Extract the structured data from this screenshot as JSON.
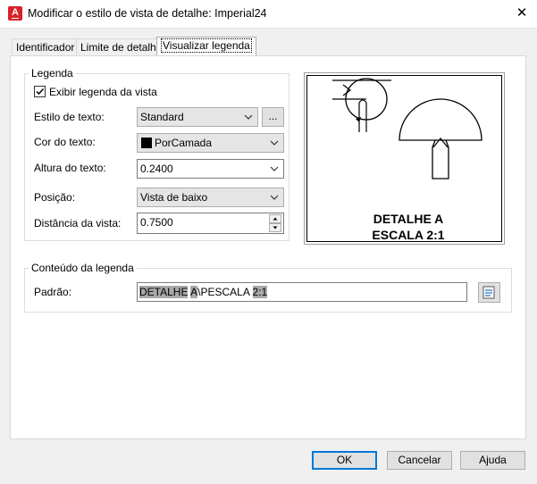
{
  "window": {
    "title": "Modificar o estilo de vista de detalhe: Imperial24",
    "app_icon_letter": "A"
  },
  "tabs": [
    {
      "label": "Identificador"
    },
    {
      "label": "Limite de detalhe"
    },
    {
      "label": "Visualizar legenda"
    }
  ],
  "legend_group": {
    "title": "Legenda",
    "show_label_checkbox": {
      "label": "Exibir legenda da vista",
      "checked": true
    },
    "text_style": {
      "label": "Estilo de texto:",
      "value": "Standard",
      "browse_label": "..."
    },
    "text_color": {
      "label": "Cor do texto:",
      "value": "PorCamada",
      "swatch_color": "#000000"
    },
    "text_height": {
      "label": "Altura do texto:",
      "value": "0.2400"
    },
    "position": {
      "label": "Posição:",
      "value": "Vista de baixo"
    },
    "distance": {
      "label": "Distância da vista:",
      "value": "0.7500"
    }
  },
  "preview": {
    "caption_line1": "DETALHE A",
    "caption_line2": "ESCALA 2:1"
  },
  "content_group": {
    "title": "Conteúdo da legenda",
    "pattern_label": "Padrão:",
    "pattern_segments": [
      {
        "text": "DETALHE",
        "highlighted": true
      },
      {
        "text": " ",
        "highlighted": false
      },
      {
        "text": "A",
        "highlighted": true
      },
      {
        "text": "\\PESCALA ",
        "highlighted": false
      },
      {
        "text": "2:1",
        "highlighted": true
      }
    ]
  },
  "buttons": {
    "ok": "OK",
    "cancel": "Cancelar",
    "help": "Ajuda"
  },
  "colors": {
    "accent": "#0078d7",
    "app_icon": "#d8222a"
  }
}
